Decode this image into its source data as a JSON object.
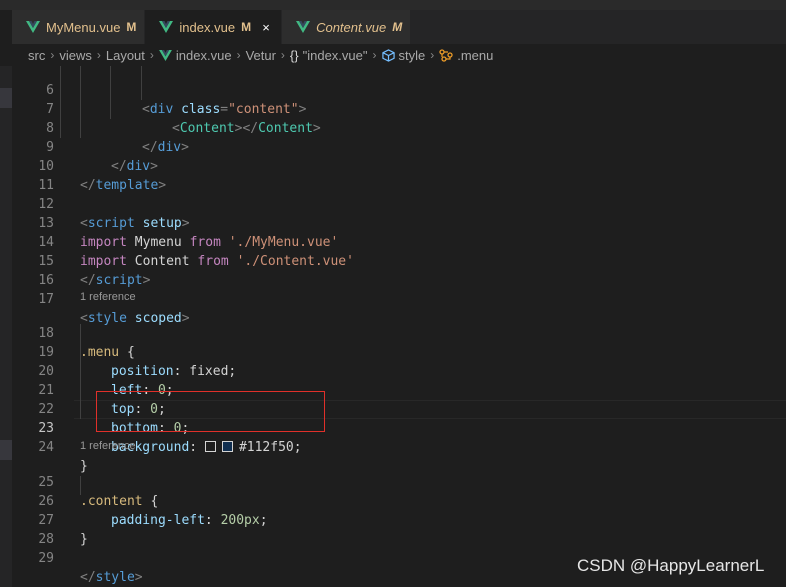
{
  "tabs": [
    {
      "label": "MyMenu.vue",
      "status": "M",
      "active": false,
      "italic": false
    },
    {
      "label": "index.vue",
      "status": "M",
      "active": true,
      "italic": false,
      "close": "×"
    },
    {
      "label": "Content.vue",
      "status": "M",
      "active": false,
      "italic": true
    }
  ],
  "breadcrumb": {
    "items": [
      "src",
      "views",
      "Layout",
      "index.vue",
      "Vetur",
      "\"index.vue\"",
      "style",
      ".menu"
    ],
    "icons": {
      "index": "vue-icon",
      "template": "{}",
      "style": "cube-icon",
      "menu": "class-icon"
    },
    "sep": "›"
  },
  "code": {
    "line_numbers": [
      "6",
      "7",
      "8",
      "9",
      "10",
      "11",
      "12",
      "13",
      "14",
      "15",
      "16",
      "17",
      "18",
      "19",
      "20",
      "21",
      "22",
      "23",
      "24",
      "25",
      "26",
      "27",
      "28",
      "29"
    ],
    "current_line": "23",
    "codelens": [
      "1 reference",
      "1 reference"
    ],
    "l6": {
      "open": "<",
      "tag": "div",
      "attr": "class",
      "eq": "=",
      "val": "\"content\"",
      "close": ">"
    },
    "l7": {
      "open": "<",
      "comp": "Content",
      "mid": "></",
      "comp2": "Content",
      "close": ">"
    },
    "l8": {
      "open": "</",
      "tag": "div",
      "close": ">"
    },
    "l9": {
      "open": "</",
      "tag": "div",
      "close": ">"
    },
    "l10": {
      "open": "</",
      "tag": "template",
      "close": ">"
    },
    "l12": {
      "open": "<",
      "tag": "script",
      "attr": "setup",
      "close": ">"
    },
    "l13": {
      "kw": "import",
      "name": "Mymenu",
      "kw2": "from",
      "str": "'./MyMenu.vue'"
    },
    "l14": {
      "kw": "import",
      "name": "Content",
      "kw2": "from",
      "str": "'./Content.vue'"
    },
    "l15": {
      "open": "</",
      "tag": "script",
      "close": ">"
    },
    "l17": {
      "open": "<",
      "tag": "style",
      "attr": "scoped",
      "close": ">"
    },
    "l18": {
      "sel": ".menu",
      "brace": "{"
    },
    "l19": {
      "prop": "position",
      "colon": ":",
      "val": "fixed",
      "semi": ";"
    },
    "l20": {
      "prop": "left",
      "colon": ":",
      "val": "0",
      "semi": ";"
    },
    "l21": {
      "prop": "top",
      "colon": ":",
      "val": "0",
      "semi": ";"
    },
    "l22": {
      "prop": "bottom",
      "colon": ":",
      "val": "0",
      "semi": ";"
    },
    "l23": {
      "prop": "background",
      "colon": ":",
      "val": "#112f50",
      "semi": ";",
      "swatch_color": "#112f50"
    },
    "l24": {
      "brace": "}"
    },
    "l25": {
      "sel": ".content",
      "brace": "{"
    },
    "l26": {
      "prop": "padding-left",
      "colon": ":",
      "val": "200px",
      "semi": ";"
    },
    "l27": {
      "brace": "}"
    },
    "l29": {
      "open": "</",
      "tag": "style",
      "close": ">"
    }
  },
  "watermark": "CSDN @HappyLearnerL",
  "colors": {
    "accent_annotation": "#e0302a",
    "vue_green": "#41b883",
    "modified": "#e2c08d"
  }
}
